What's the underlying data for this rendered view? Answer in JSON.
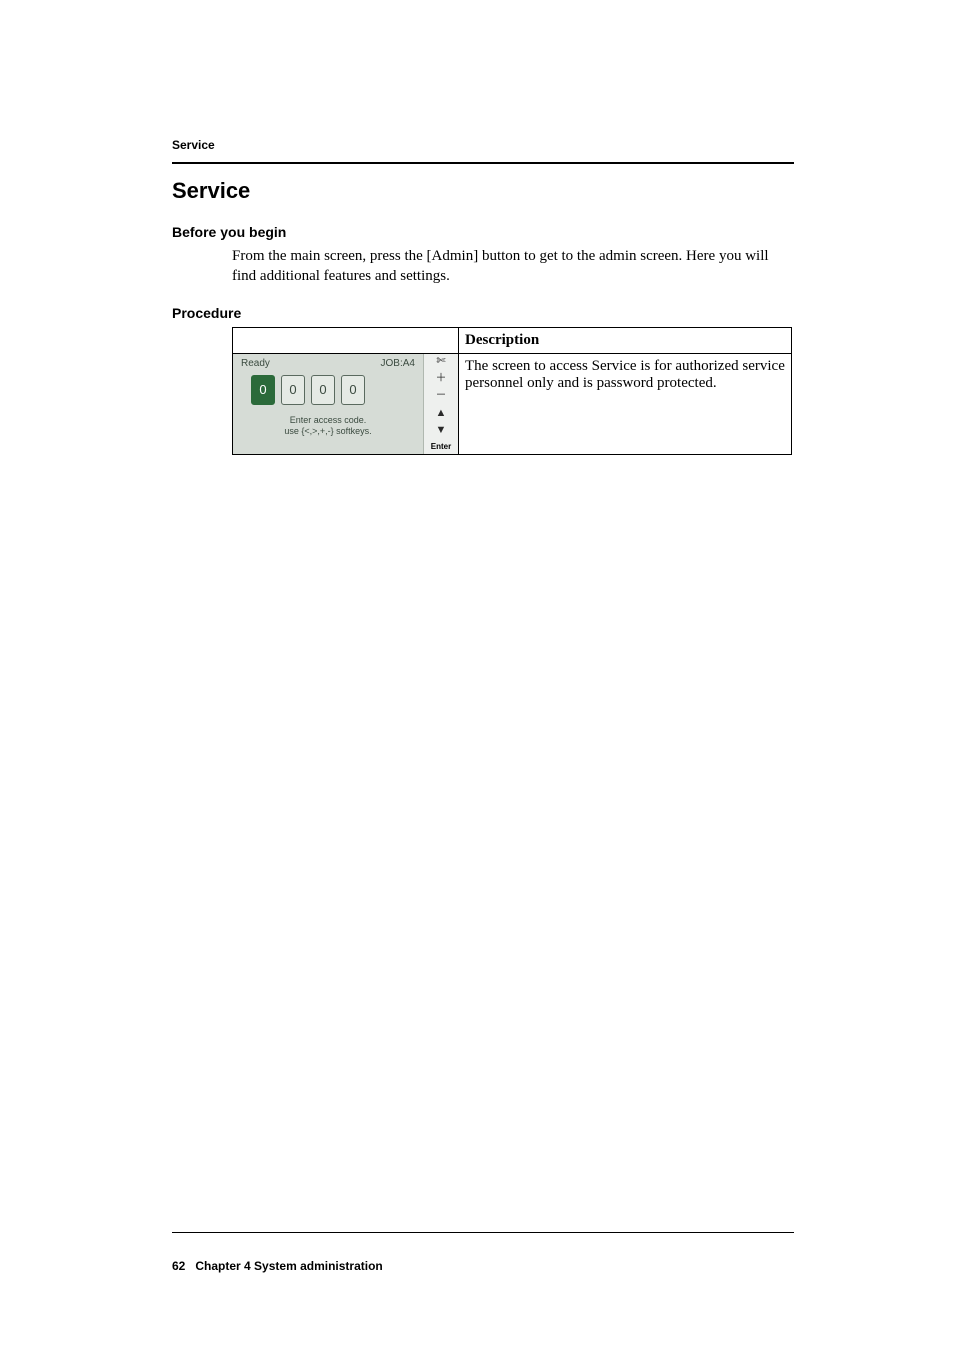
{
  "runningHead": "Service",
  "title": "Service",
  "before": {
    "heading": "Before you begin",
    "text": "From the main screen, press the [Admin] button to get to the admin screen. Here you will find additional features and settings."
  },
  "procedure": {
    "heading": "Procedure",
    "descHeader": "Description",
    "row": {
      "description": "The screen to access Service is for authorized service personnel only and is password protected."
    }
  },
  "screen": {
    "status": "Ready",
    "job": "JOB:A4",
    "digits": [
      "0",
      "0",
      "0",
      "0"
    ],
    "hint1": "Enter access code.",
    "hint2": "use {<,>,+,-} softkeys.",
    "side": {
      "tool": "✄",
      "plus": "＋",
      "minus": "－",
      "up": "▲",
      "down": "▼",
      "enter": "Enter"
    }
  },
  "footer": {
    "page": "62",
    "chapter": "Chapter 4 System administration"
  }
}
